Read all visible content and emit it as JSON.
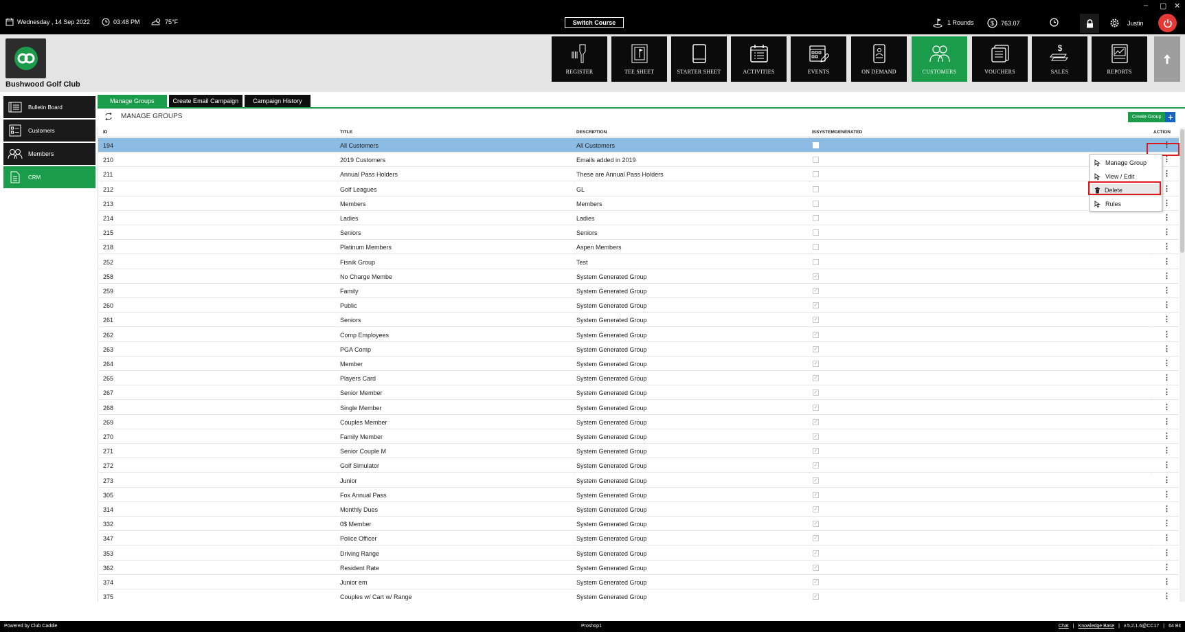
{
  "window": {
    "minimize": "–",
    "restore": "▢",
    "close": "✕"
  },
  "topbar": {
    "date": "Wednesday ,  14 Sep 2022",
    "time": "03:48 PM",
    "weather": "75°F",
    "switch_course": "Switch Course",
    "rounds": "1 Rounds",
    "balance": "763.07",
    "user": "Justin"
  },
  "club": {
    "name": "Bushwood Golf Club"
  },
  "nav": [
    {
      "label": "REGISTER",
      "icon": "barcode-scanner-icon"
    },
    {
      "label": "TEE SHEET",
      "icon": "tee-sheet-icon"
    },
    {
      "label": "STARTER SHEET",
      "icon": "tablet-icon"
    },
    {
      "label": "ACTIVITIES",
      "icon": "calendar-list-icon"
    },
    {
      "label": "EVENTS",
      "icon": "calendar-edit-icon"
    },
    {
      "label": "ON DEMAND",
      "icon": "mobile-order-icon"
    },
    {
      "label": "CUSTOMERS",
      "icon": "customers-icon",
      "active": true
    },
    {
      "label": "VOUCHERS",
      "icon": "voucher-icon"
    },
    {
      "label": "SALES",
      "icon": "sales-icon"
    },
    {
      "label": "REPORTS",
      "icon": "reports-icon"
    }
  ],
  "sidebar": {
    "items": [
      {
        "label": "Bulletin Board"
      },
      {
        "label": "Customers"
      },
      {
        "label": "Members"
      },
      {
        "label": "CRM",
        "active": true
      }
    ]
  },
  "tabs": [
    {
      "label": "Manage Groups",
      "active": true
    },
    {
      "label": "Create Email Campaign"
    },
    {
      "label": "Campaign History"
    }
  ],
  "manage": {
    "title": "MANAGE GROUPS",
    "create_label": "Create Group",
    "create_plus": "+"
  },
  "columns": {
    "id": "ID",
    "title": "TITLE",
    "description": "DESCRIPTION",
    "system": "ISSYSTEMGENERATED",
    "action": "ACTION"
  },
  "rows": [
    {
      "id": "194",
      "title": "All Customers",
      "description": "All Customers",
      "system": false,
      "selected": true
    },
    {
      "id": "210",
      "title": "2019 Customers",
      "description": "Emails added in 2019",
      "system": false
    },
    {
      "id": "211",
      "title": "Annual Pass Holders",
      "description": "These are Annual Pass Holders",
      "system": false
    },
    {
      "id": "212",
      "title": "Golf Leagues",
      "description": "GL",
      "system": false
    },
    {
      "id": "213",
      "title": "Members",
      "description": "Members",
      "system": false
    },
    {
      "id": "214",
      "title": "Ladies",
      "description": "Ladies",
      "system": false
    },
    {
      "id": "215",
      "title": "Seniors",
      "description": "Seniors",
      "system": false
    },
    {
      "id": "218",
      "title": "Platinum Members",
      "description": "Aspen Members",
      "system": false
    },
    {
      "id": "252",
      "title": "Fisnik Group",
      "description": "Test",
      "system": false
    },
    {
      "id": "258",
      "title": "No Charge Membe",
      "description": "System Generated Group",
      "system": true
    },
    {
      "id": "259",
      "title": "Family",
      "description": "System Generated Group",
      "system": true
    },
    {
      "id": "260",
      "title": "Public",
      "description": "System Generated Group",
      "system": true
    },
    {
      "id": "261",
      "title": "Seniors",
      "description": "System Generated Group",
      "system": true
    },
    {
      "id": "262",
      "title": "Comp Employees",
      "description": "System Generated Group",
      "system": true
    },
    {
      "id": "263",
      "title": "PGA Comp",
      "description": "System Generated Group",
      "system": true
    },
    {
      "id": "264",
      "title": "Member",
      "description": "System Generated Group",
      "system": true
    },
    {
      "id": "265",
      "title": "Players Card",
      "description": "System Generated Group",
      "system": true
    },
    {
      "id": "267",
      "title": "Senior Member",
      "description": "System Generated Group",
      "system": true
    },
    {
      "id": "268",
      "title": "Single Member",
      "description": "System Generated Group",
      "system": true
    },
    {
      "id": "269",
      "title": "Couples Member",
      "description": "System Generated Group",
      "system": true
    },
    {
      "id": "270",
      "title": "Family Member",
      "description": "System Generated Group",
      "system": true
    },
    {
      "id": "271",
      "title": "Senior Couple M",
      "description": "System Generated Group",
      "system": true
    },
    {
      "id": "272",
      "title": "Golf Simulator",
      "description": "System Generated Group",
      "system": true
    },
    {
      "id": "273",
      "title": "Junior",
      "description": "System Generated Group",
      "system": true
    },
    {
      "id": "305",
      "title": "Fox Annual Pass",
      "description": "System Generated Group",
      "system": true
    },
    {
      "id": "314",
      "title": "Monthly Dues",
      "description": "System Generated Group",
      "system": true
    },
    {
      "id": "332",
      "title": "0$ Member",
      "description": "System Generated Group",
      "system": true
    },
    {
      "id": "347",
      "title": "Police Officer",
      "description": "System Generated Group",
      "system": true
    },
    {
      "id": "353",
      "title": "Driving Range",
      "description": "System Generated Group",
      "system": true
    },
    {
      "id": "362",
      "title": "Resident Rate",
      "description": "System Generated Group",
      "system": true
    },
    {
      "id": "374",
      "title": "Junior em",
      "description": "System Generated Group",
      "system": true
    },
    {
      "id": "375",
      "title": "Couples w/ Cart w/ Range",
      "description": "System Generated Group",
      "system": true
    }
  ],
  "context_menu": {
    "items": [
      {
        "label": "Manage Group",
        "icon": "pointer-icon"
      },
      {
        "label": "View / Edit",
        "icon": "pointer-icon"
      },
      {
        "label": "Delete",
        "icon": "trash-icon",
        "highlighted": true
      },
      {
        "label": "Rules",
        "icon": "pointer-icon"
      }
    ]
  },
  "footer": {
    "left": "Powered by Club Caddie",
    "center": "Proshop1",
    "chat": "Chat",
    "sep": "|",
    "kb": "Knowledge Base",
    "version": "v.5.2.1.6@CC17",
    "bits": "64 Bit"
  },
  "colors": {
    "accent_green": "#1a9c4b",
    "selected_row": "#8cbbe4",
    "power_red": "#e53935",
    "highlight_red": "#e0191e"
  }
}
